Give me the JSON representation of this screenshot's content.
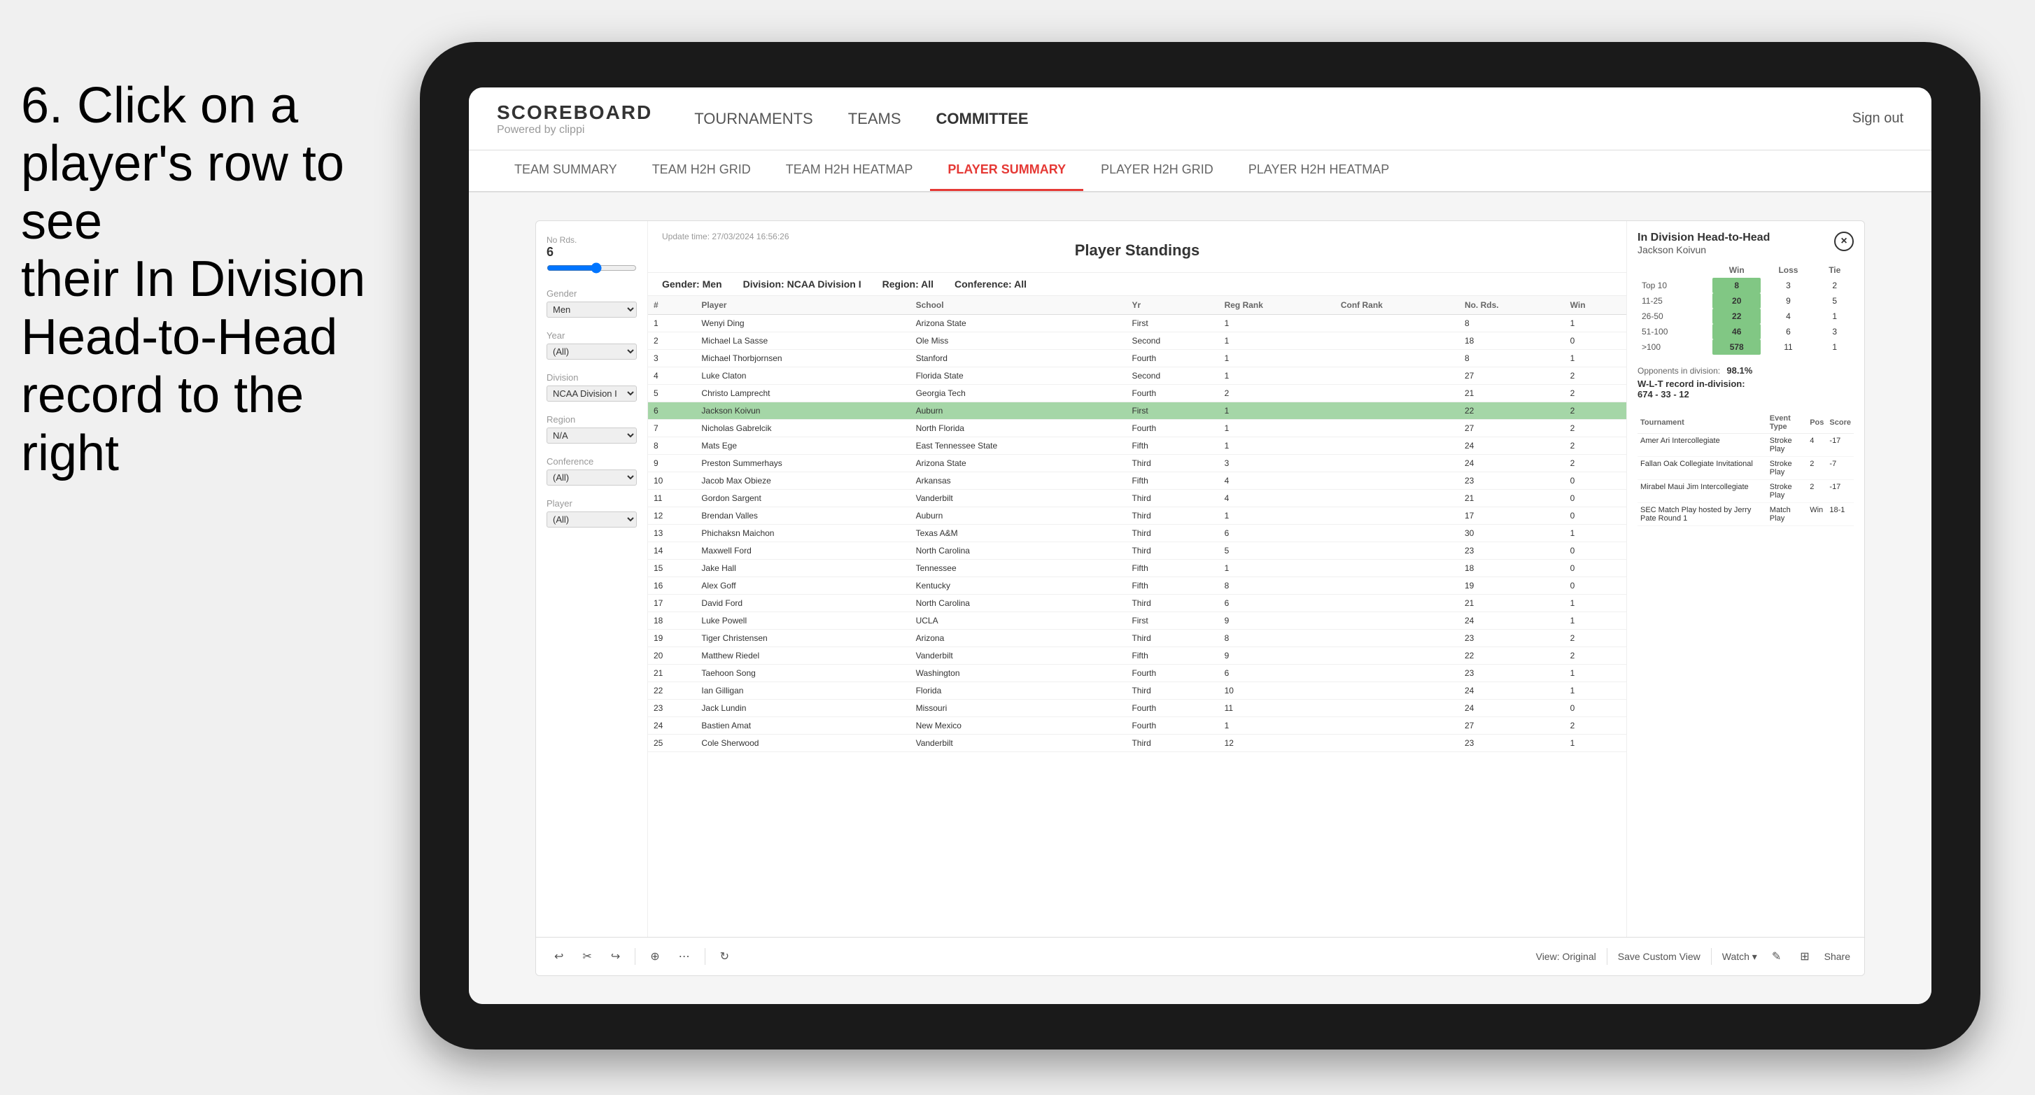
{
  "instruction": {
    "line1": "6. Click on a",
    "line2": "player's row to see",
    "line3": "their In Division",
    "line4": "Head-to-Head",
    "line5": "record to the right"
  },
  "nav": {
    "logo_title": "SCOREBOARD",
    "logo_sub": "Powered by clippi",
    "links": [
      "TOURNAMENTS",
      "TEAMS",
      "COMMITTEE"
    ],
    "sign_out": "Sign out"
  },
  "sub_nav": {
    "items": [
      "TEAM SUMMARY",
      "TEAM H2H GRID",
      "TEAM H2H HEATMAP",
      "PLAYER SUMMARY",
      "PLAYER H2H GRID",
      "PLAYER H2H HEATMAP"
    ],
    "active": "PLAYER SUMMARY"
  },
  "standings": {
    "title": "Player Standings",
    "update_time": "Update time:",
    "update_value": "27/03/2024 16:56:26",
    "gender_label": "Gender:",
    "gender_value": "Men",
    "division_label": "Division:",
    "division_value": "NCAA Division I",
    "region_label": "Region:",
    "region_value": "All",
    "conference_label": "Conference:",
    "conference_value": "All"
  },
  "filters": {
    "no_rds_label": "No Rds.",
    "no_rds_value": "6",
    "gender_label": "Gender",
    "gender_value": "Men",
    "year_label": "Year",
    "year_value": "(All)",
    "division_label": "Division",
    "division_value": "NCAA Division I",
    "region_label": "Region",
    "region_value": "N/A",
    "conference_label": "Conference",
    "conference_value": "(All)",
    "player_label": "Player",
    "player_value": "(All)"
  },
  "table": {
    "headers": [
      "#",
      "Player",
      "School",
      "Yr",
      "Reg Rank",
      "Conf Rank",
      "No. Rds.",
      "Win"
    ],
    "rows": [
      {
        "num": 1,
        "player": "Wenyi Ding",
        "school": "Arizona State",
        "yr": "First",
        "reg": 1,
        "conf": "",
        "rds": 8,
        "win": 1,
        "selected": false
      },
      {
        "num": 2,
        "player": "Michael La Sasse",
        "school": "Ole Miss",
        "yr": "Second",
        "reg": 1,
        "conf": "",
        "rds": 18,
        "win": 0,
        "selected": false
      },
      {
        "num": 3,
        "player": "Michael Thorbjornsen",
        "school": "Stanford",
        "yr": "Fourth",
        "reg": 1,
        "conf": "",
        "rds": 8,
        "win": 1,
        "selected": false
      },
      {
        "num": 4,
        "player": "Luke Claton",
        "school": "Florida State",
        "yr": "Second",
        "reg": 1,
        "conf": "",
        "rds": 27,
        "win": 2,
        "selected": false
      },
      {
        "num": 5,
        "player": "Christo Lamprecht",
        "school": "Georgia Tech",
        "yr": "Fourth",
        "reg": 2,
        "conf": "",
        "rds": 21,
        "win": 2,
        "selected": false
      },
      {
        "num": 6,
        "player": "Jackson Koivun",
        "school": "Auburn",
        "yr": "First",
        "reg": 1,
        "conf": "",
        "rds": 22,
        "win": 2,
        "selected": true
      },
      {
        "num": 7,
        "player": "Nicholas Gabrelcik",
        "school": "North Florida",
        "yr": "Fourth",
        "reg": 1,
        "conf": "",
        "rds": 27,
        "win": 2,
        "selected": false
      },
      {
        "num": 8,
        "player": "Mats Ege",
        "school": "East Tennessee State",
        "yr": "Fifth",
        "reg": 1,
        "conf": "",
        "rds": 24,
        "win": 2,
        "selected": false
      },
      {
        "num": 9,
        "player": "Preston Summerhays",
        "school": "Arizona State",
        "yr": "Third",
        "reg": 3,
        "conf": "",
        "rds": 24,
        "win": 2,
        "selected": false
      },
      {
        "num": 10,
        "player": "Jacob Max Obieze",
        "school": "Arkansas",
        "yr": "Fifth",
        "reg": 4,
        "conf": "",
        "rds": 23,
        "win": 0,
        "selected": false
      },
      {
        "num": 11,
        "player": "Gordon Sargent",
        "school": "Vanderbilt",
        "yr": "Third",
        "reg": 4,
        "conf": "",
        "rds": 21,
        "win": 0,
        "selected": false
      },
      {
        "num": 12,
        "player": "Brendan Valles",
        "school": "Auburn",
        "yr": "Third",
        "reg": 1,
        "conf": "",
        "rds": 17,
        "win": 0,
        "selected": false
      },
      {
        "num": 13,
        "player": "Phichaksn Maichon",
        "school": "Texas A&M",
        "yr": "Third",
        "reg": 6,
        "conf": "",
        "rds": 30,
        "win": 1,
        "selected": false
      },
      {
        "num": 14,
        "player": "Maxwell Ford",
        "school": "North Carolina",
        "yr": "Third",
        "reg": 5,
        "conf": "",
        "rds": 23,
        "win": 0,
        "selected": false
      },
      {
        "num": 15,
        "player": "Jake Hall",
        "school": "Tennessee",
        "yr": "Fifth",
        "reg": 1,
        "conf": "",
        "rds": 18,
        "win": 0,
        "selected": false
      },
      {
        "num": 16,
        "player": "Alex Goff",
        "school": "Kentucky",
        "yr": "Fifth",
        "reg": 8,
        "conf": "",
        "rds": 19,
        "win": 0,
        "selected": false
      },
      {
        "num": 17,
        "player": "David Ford",
        "school": "North Carolina",
        "yr": "Third",
        "reg": 6,
        "conf": "",
        "rds": 21,
        "win": 1,
        "selected": false
      },
      {
        "num": 18,
        "player": "Luke Powell",
        "school": "UCLA",
        "yr": "First",
        "reg": 9,
        "conf": "",
        "rds": 24,
        "win": 1,
        "selected": false
      },
      {
        "num": 19,
        "player": "Tiger Christensen",
        "school": "Arizona",
        "yr": "Third",
        "reg": 8,
        "conf": "",
        "rds": 23,
        "win": 2,
        "selected": false
      },
      {
        "num": 20,
        "player": "Matthew Riedel",
        "school": "Vanderbilt",
        "yr": "Fifth",
        "reg": 9,
        "conf": "",
        "rds": 22,
        "win": 2,
        "selected": false
      },
      {
        "num": 21,
        "player": "Taehoon Song",
        "school": "Washington",
        "yr": "Fourth",
        "reg": 6,
        "conf": "",
        "rds": 23,
        "win": 1,
        "selected": false
      },
      {
        "num": 22,
        "player": "Ian Gilligan",
        "school": "Florida",
        "yr": "Third",
        "reg": 10,
        "conf": "",
        "rds": 24,
        "win": 1,
        "selected": false
      },
      {
        "num": 23,
        "player": "Jack Lundin",
        "school": "Missouri",
        "yr": "Fourth",
        "reg": 11,
        "conf": "",
        "rds": 24,
        "win": 0,
        "selected": false
      },
      {
        "num": 24,
        "player": "Bastien Amat",
        "school": "New Mexico",
        "yr": "Fourth",
        "reg": 1,
        "conf": "",
        "rds": 27,
        "win": 2,
        "selected": false
      },
      {
        "num": 25,
        "player": "Cole Sherwood",
        "school": "Vanderbilt",
        "yr": "Third",
        "reg": 12,
        "conf": "",
        "rds": 23,
        "win": 1,
        "selected": false
      }
    ]
  },
  "h2h": {
    "title": "In Division Head-to-Head",
    "player_name": "Jackson Koivun",
    "close_btn": "×",
    "col_headers": [
      "Win",
      "Loss",
      "Tie"
    ],
    "rows": [
      {
        "label": "Top 10",
        "win": 8,
        "loss": 3,
        "tie": 2
      },
      {
        "label": "11-25",
        "win": 20,
        "loss": 9,
        "tie": 5
      },
      {
        "label": "26-50",
        "win": 22,
        "loss": 4,
        "tie": 1
      },
      {
        "label": "51-100",
        "win": 46,
        "loss": 6,
        "tie": 3
      },
      {
        "label": ">100",
        "win": 578,
        "loss": 11,
        "tie": 1
      }
    ],
    "opponents_label": "Opponents in division:",
    "wlt_label": "W-L-T record in-division:",
    "pct": "98.1%",
    "record": "674 - 33 - 12",
    "tournament_headers": [
      "Tournament",
      "Event Type",
      "Pos",
      "Score"
    ],
    "tournaments": [
      {
        "name": "Amer Ari Intercollegiate",
        "type": "Stroke Play",
        "pos": 4,
        "score": "-17"
      },
      {
        "name": "Fallan Oak Collegiate Invitational",
        "type": "Stroke Play",
        "pos": 2,
        "score": "-7"
      },
      {
        "name": "Mirabel Maui Jim Intercollegiate",
        "type": "Stroke Play",
        "pos": 2,
        "score": "-17"
      },
      {
        "name": "SEC Match Play hosted by Jerry Pate Round 1",
        "type": "Match Play",
        "pos": "Win",
        "score": "18-1"
      }
    ]
  },
  "toolbar": {
    "view_original": "View: Original",
    "save_custom": "Save Custom View",
    "watch": "Watch ▾",
    "share": "Share"
  }
}
